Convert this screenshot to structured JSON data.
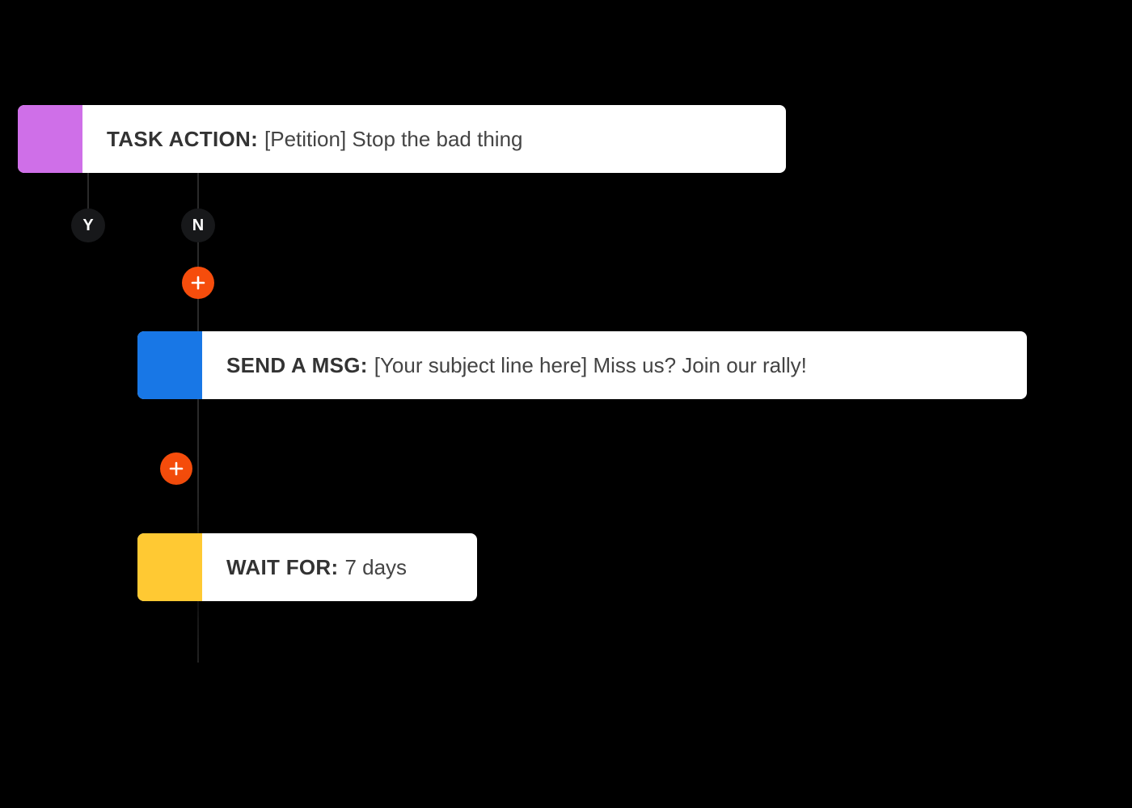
{
  "colors": {
    "task_action": "#cf6fe8",
    "send_msg": "#1877e6",
    "wait_for": "#ffc933",
    "add_btn": "#f64d0c",
    "badge_bg": "#17181a"
  },
  "nodes": {
    "task_action": {
      "label": "TASK ACTION:",
      "value": "[Petition] Stop the bad thing"
    },
    "send_msg": {
      "label": "SEND A MSG:",
      "value": "[Your subject line here] Miss us? Join our rally!"
    },
    "wait_for": {
      "label": "WAIT FOR:",
      "value": "7 days"
    }
  },
  "branches": {
    "yes": "Y",
    "no": "N"
  }
}
